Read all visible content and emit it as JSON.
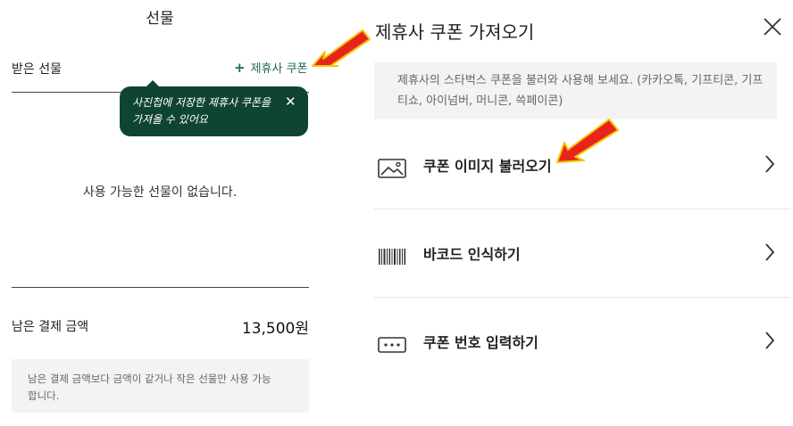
{
  "left": {
    "title": "선물",
    "received_label": "받은 선물",
    "partner_coupon_button": "제휴사 쿠폰",
    "tooltip_text": "사진첩에 저장한 제휴사 쿠폰을 가져올 수 있어요",
    "empty_message": "사용 가능한 선물이 없습니다.",
    "remaining_label": "남은 결제 금액",
    "remaining_amount": "13,500원",
    "notice": "남은 결제 금액보다 금액이 같거나 작은 선물만 사용 가능합니다."
  },
  "right": {
    "title": "제휴사 쿠폰 가져오기",
    "info": "제휴사의 스타벅스 쿠폰을 불러와 사용해 보세요. (카카오톡, 기프티콘, 기프티쇼, 아이넘버, 머니콘, 쓱페이콘)",
    "menu": [
      {
        "label": "쿠폰 이미지 불러오기",
        "icon": "image-icon"
      },
      {
        "label": "바코드 인식하기",
        "icon": "barcode-icon"
      },
      {
        "label": "쿠폰 번호 입력하기",
        "icon": "keypad-icon"
      }
    ]
  },
  "colors": {
    "accent_green": "#1e6b45",
    "tooltip_bg": "#0f4433",
    "annotation_arrow": "#e8231c"
  }
}
